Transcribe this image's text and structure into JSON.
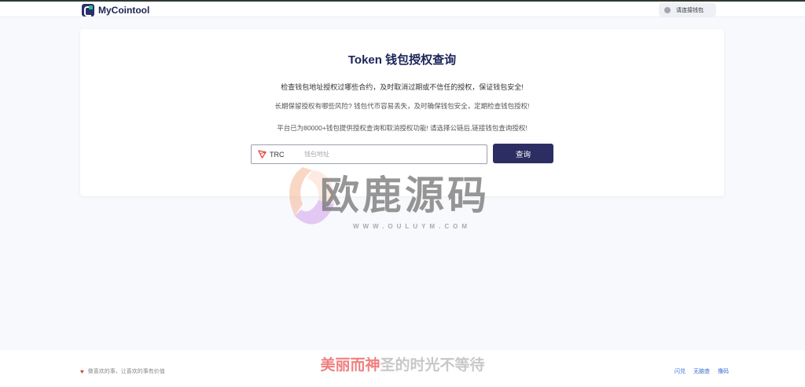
{
  "header": {
    "brand": "MyCointool",
    "connect_wallet": "请连接钱包"
  },
  "card": {
    "title": "Token 钱包授权查询",
    "line1": "检查钱包地址授权过哪些合约，及时取消过期或不信任的授权，保证钱包安全!",
    "line2": "长期保留授权有哪些风险? 钱包代币容易丢失，及时确保钱包安全，定期检查钱包授权!",
    "line3": "平台已为80000+钱包提供授权查询和取消授权功能! 请选择公链后,链接钱包查询授权!",
    "chain": "TRC",
    "address_placeholder": "钱包地址",
    "address_value": "",
    "query_button": "查询"
  },
  "watermark": {
    "text": "欧鹿源码",
    "url": "WWW.OULUYM.COM"
  },
  "footer": {
    "slogan": "做喜欢的事，让喜欢的事有价值",
    "links": [
      "闪兑",
      "无脑查",
      "撸码"
    ]
  },
  "subtitle": {
    "highlighted": "美丽而神",
    "rest": "圣的时光不等待"
  },
  "colors": {
    "primary": "#2c2e63",
    "title": "#1c2359",
    "link": "#3a6fd6",
    "background": "#f8f9fc"
  }
}
